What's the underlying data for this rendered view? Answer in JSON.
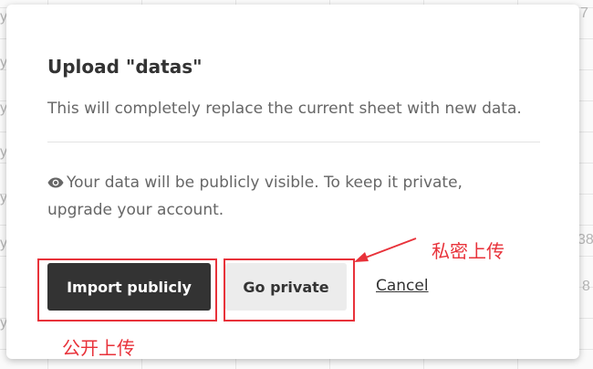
{
  "background": {
    "cells": [
      {
        "text": "y"
      },
      {
        "text": "y"
      },
      {
        "text": "y"
      },
      {
        "text": "y"
      },
      {
        "text": "y"
      },
      {
        "text": "y"
      },
      {
        "text": "y"
      },
      {
        "text": "7"
      },
      {
        "text": "38"
      },
      {
        "text": "8"
      }
    ]
  },
  "dialog": {
    "title": "Upload \"datas\"",
    "subtitle": "This will completely replace the current sheet with new data.",
    "notice_icon": "eye-icon",
    "notice_text": "Your data will be publicly visible. To keep it private, upgrade your account.",
    "buttons": {
      "import_publicly": "Import publicly",
      "go_private": "Go private",
      "cancel": "Cancel"
    }
  },
  "annotations": {
    "go_private_label": "私密上传",
    "import_publicly_label": "公开上传",
    "color": "#e8323a"
  },
  "colors": {
    "primary_button": "#333333",
    "secondary_button": "#ececec",
    "annotation": "#e8323a"
  }
}
